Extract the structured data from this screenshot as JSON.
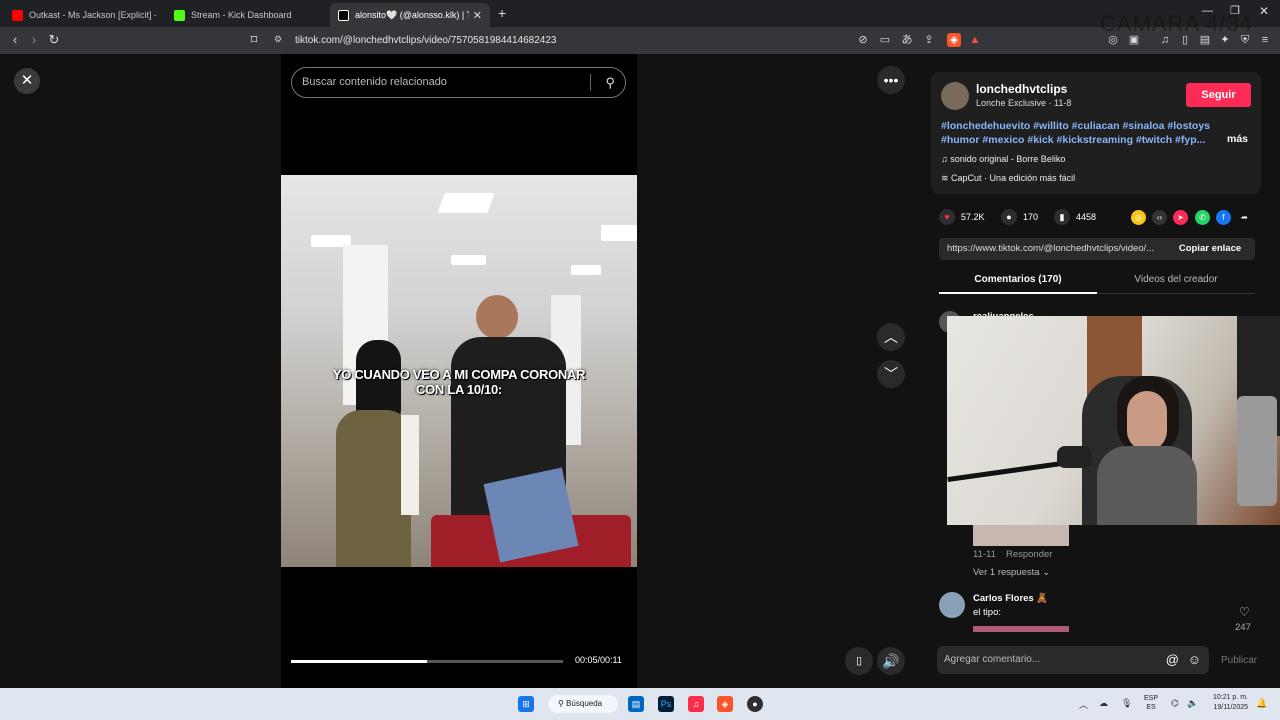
{
  "browser": {
    "tabs": [
      {
        "title": "Outkast - Ms Jackson [Explicit] - YouTube",
        "favicon_color": "#ff0000"
      },
      {
        "title": "Stream - Kick Dashboard",
        "favicon_color": "#53fc18"
      },
      {
        "title": "alonsito🤍 (@alonsso.klk) | TikTok",
        "favicon_color": "#ffffff"
      }
    ],
    "url": "tiktok.com/@lonchedhvtclips/video/7570581984414682423",
    "new_tab_icon": "plus-icon"
  },
  "overlay_text": "CAMARA 4/34",
  "video": {
    "search_placeholder": "Buscar contenido relacionado",
    "caption": "YO CUANDO VEO A MI COMPA CORONAR CON LA 10/10:",
    "time": "00:05/00:11",
    "progress_fraction": 0.5
  },
  "creator": {
    "username": "lonchedhvtclips",
    "subtitle": "Lonche Exclusive · 11-8",
    "follow_label": "Seguir",
    "hashtags": "#lonchedehuevito #willito #culiacan #sinaloa #lostoys #humor #mexico #kick #kickstreaming #twitch #fyp...",
    "more_label": "más",
    "sound": "sonido original - Borre Beliko",
    "capcut": "CapCut · Una edición más fácil"
  },
  "stats": {
    "likes": "57.2K",
    "comments": "170",
    "saves": "4458"
  },
  "link": {
    "url": "https://www.tiktok.com/@lonchedhvtclips/video/...",
    "copy_label": "Copiar enlace"
  },
  "comment_tabs": [
    {
      "label": "Comentarios (170)"
    },
    {
      "label": "Videos del creador"
    }
  ],
  "comments": {
    "first_user_partial": "realiuangeles",
    "date": "11-11",
    "reply_label": "Responder",
    "see_replies": "Ver 1 respuesta",
    "second_user": "Carlos Flores 🧸",
    "second_text": "el tipo:",
    "second_likes": "247"
  },
  "composer": {
    "placeholder": "Agregar comentario...",
    "post_label": "Publicar"
  },
  "taskbar": {
    "search_label": "Búsqueda",
    "lang": "ESP",
    "lang2": "ES",
    "time": "10:21 p. m.",
    "date": "19/11/2025"
  }
}
